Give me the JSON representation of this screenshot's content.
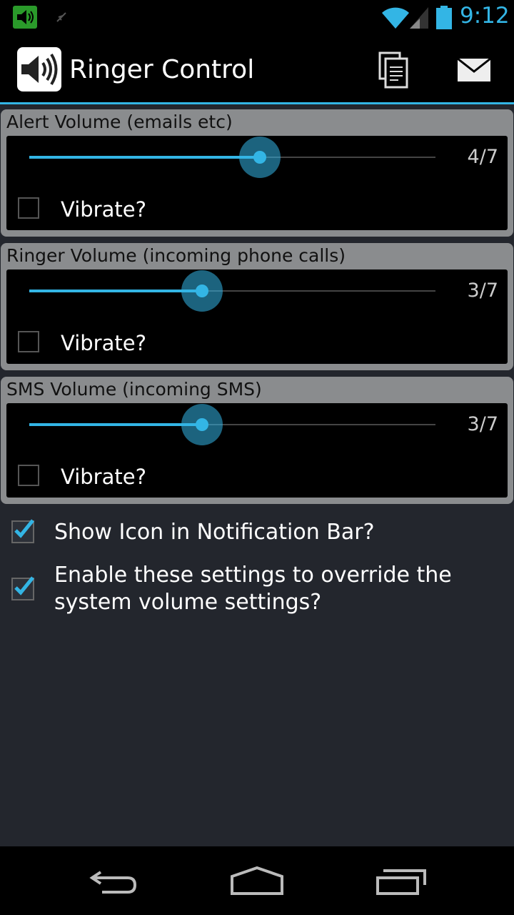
{
  "status_bar": {
    "time": "9:12"
  },
  "app": {
    "title": "Ringer Control"
  },
  "groups": [
    {
      "title": "Alert Volume (emails etc)",
      "value_text": "4/7",
      "level": 4,
      "max": 7,
      "vibrate_label": "Vibrate?",
      "vibrate_checked": false
    },
    {
      "title": "Ringer Volume (incoming phone calls)",
      "value_text": "3/7",
      "level": 3,
      "max": 7,
      "vibrate_label": "Vibrate?",
      "vibrate_checked": false
    },
    {
      "title": "SMS Volume (incoming SMS)",
      "value_text": "3/7",
      "level": 3,
      "max": 7,
      "vibrate_label": "Vibrate?",
      "vibrate_checked": false
    }
  ],
  "options": [
    {
      "label": "Show Icon in Notification Bar?",
      "checked": true
    },
    {
      "label": "Enable these settings to override the system volume settings?",
      "checked": true
    }
  ],
  "colors": {
    "accent": "#33b5e5",
    "background": "#23262d",
    "panel": "#8a8c8e"
  },
  "icons": {
    "status_left": [
      "speaker-icon",
      "usb-icon"
    ],
    "status_right": [
      "wifi-icon",
      "signal-icon",
      "battery-icon"
    ],
    "action_bar": [
      "copy-icon",
      "mail-icon"
    ],
    "navigation": [
      "back-icon",
      "home-icon",
      "recent-apps-icon"
    ]
  }
}
